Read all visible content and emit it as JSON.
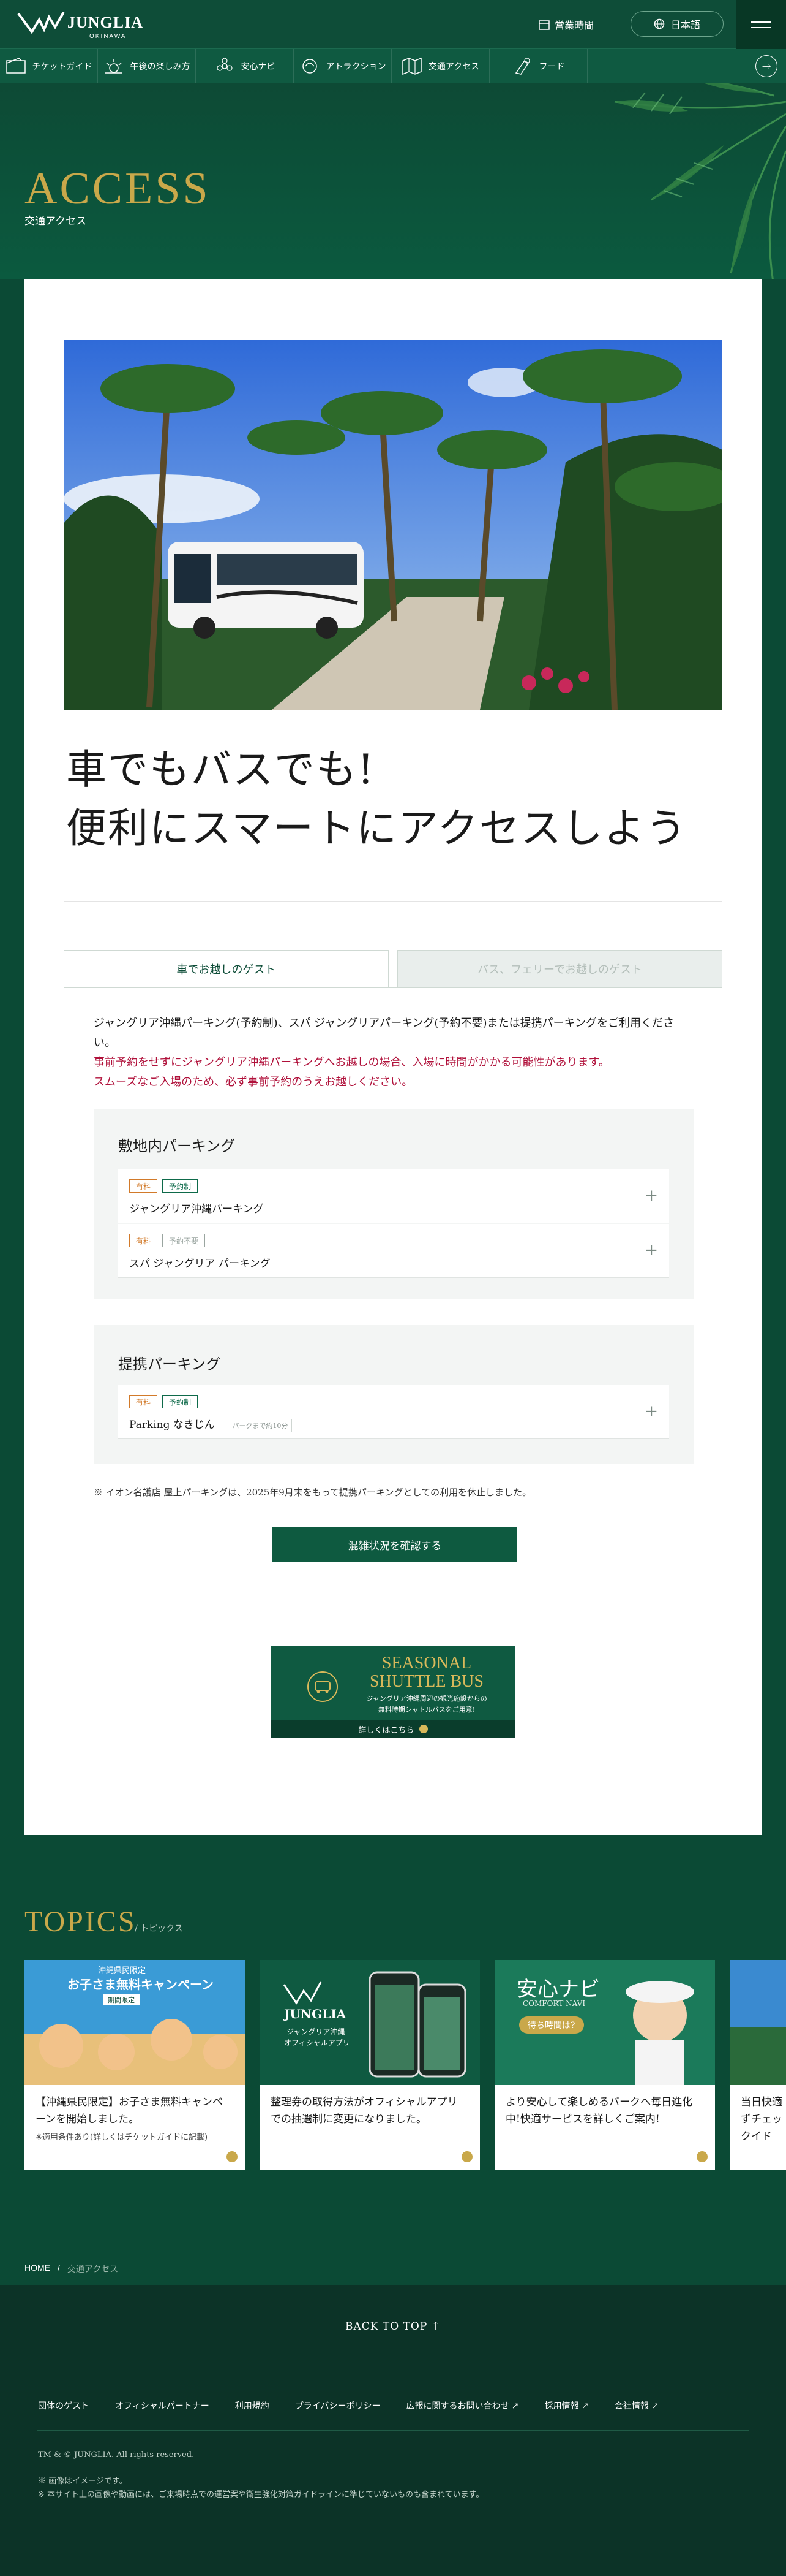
{
  "header": {
    "logo_text": "JUNGLIA",
    "logo_sub": "OKINAWA",
    "hours_label": "営業時間",
    "lang_label": "日本語"
  },
  "nav": {
    "items": [
      {
        "label": "チケットガイド",
        "icon": "ticket-icon"
      },
      {
        "label": "午後の楽しみ方",
        "icon": "sun-icon"
      },
      {
        "label": "安心ナビ",
        "icon": "flower-icon"
      },
      {
        "label": "アトラクション",
        "icon": "attraction-icon"
      },
      {
        "label": "交通アクセス",
        "icon": "map-icon"
      },
      {
        "label": "フード",
        "icon": "food-icon"
      }
    ]
  },
  "hero": {
    "title": "ACCESS",
    "subtitle": "交通アクセス"
  },
  "main": {
    "headline_line1": "車でもバスでも!",
    "headline_line2": "便利にスマートにアクセスしよう",
    "tabs": [
      {
        "label": "車でお越しのゲスト",
        "active": true
      },
      {
        "label": "バス、フェリーでお越しのゲスト",
        "active": false
      }
    ],
    "intro": "ジャングリア沖縄パーキング(予約制)、スパ ジャングリアパーキング(予約不要)または提携パーキングをご利用ください。",
    "warn1": "事前予約をせずにジャングリア沖縄パーキングへお越しの場合、入場に時間がかかる可能性があります。",
    "warn2": "スムーズなご入場のため、必ず事前予約のうえお越しください。",
    "onsite_title": "敷地内パーキング",
    "onsite_rows": [
      {
        "tag1": "有料",
        "tag2": "予約制",
        "name": "ジャングリア沖縄パーキング"
      },
      {
        "tag1": "有料",
        "tag2": "予約不要",
        "name": "スパ ジャングリア パーキング"
      }
    ],
    "partner_title": "提携パーキング",
    "partner_rows": [
      {
        "tag1": "有料",
        "tag2": "予約制",
        "name": "Parking なきじん",
        "note": "パークまで約10分"
      }
    ],
    "notice": "※ イオン名護店 屋上パーキングは、2025年9月末をもって提携パーキングとしての利用を休止しました。",
    "check_button": "混雑状況を確認する"
  },
  "shuttle": {
    "title_line1": "SEASONAL",
    "title_line2": "SHUTTLE BUS",
    "desc1": "ジャングリア沖縄周辺の観光施設からの",
    "desc2": "無料時期シャトルバスをご用意!",
    "link": "詳しくはこちら"
  },
  "topics": {
    "title": "TOPICS",
    "subtitle": "/ トピックス",
    "items": [
      {
        "text": "【沖縄県民限定】お子さま無料キャンペーンを開始しました。",
        "small": "※適用条件あり(詳しくはチケットガイドに記載)",
        "banner1": "沖縄県民限定",
        "banner2": "お子さま無料キャンペーン",
        "banner3": "期間限定",
        "image_label": ""
      },
      {
        "text": "整理券の取得方法がオフィシャルアプリでの抽選制に変更になりました。",
        "small": "",
        "banner1": "JUNGLIA",
        "banner2": "ジャングリア沖縄",
        "banner3": "オフィシャルアプリ"
      },
      {
        "text": "より安心して楽しめるパークへ毎日進化中!快適サービスを詳しくご案内!",
        "small": "",
        "banner1": "安心ナビ",
        "banner2": "COMFORT NAVI",
        "banner3": "待ち時間は?"
      },
      {
        "text": "当日快適ずチェックイド",
        "small": "",
        "banner1": "",
        "banner2": "",
        "banner3": ""
      }
    ]
  },
  "breadcrumb": {
    "home": "HOME",
    "sep": "/",
    "current": "交通アクセス"
  },
  "footer": {
    "back_to_top": "BACK TO TOP ↑",
    "links": [
      "団体のゲスト",
      "オフィシャルパートナー",
      "利用規約",
      "プライバシーポリシー",
      "広報に関するお問い合わせ ↗",
      "採用情報 ↗",
      "会社情報 ↗"
    ],
    "copyright": "TM & © JUNGLIA. All rights reserved.",
    "note1": "※ 画像はイメージです。",
    "note2": "※ 本サイト上の画像や動画には、ご来場時点での運営案や衛生強化対策ガイドラインに準じていないものも含まれています。"
  },
  "colors": {
    "brand_green": "#0e4d38",
    "gold": "#c9a84a",
    "warn_red": "#b0103a"
  }
}
